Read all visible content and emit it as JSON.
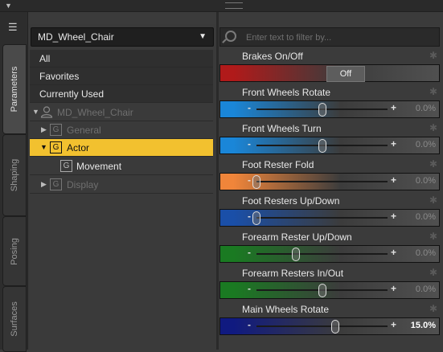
{
  "side_tabs": [
    "Parameters",
    "Shaping",
    "Posing",
    "Surfaces"
  ],
  "figure_dropdown": {
    "value": "MD_Wheel_Chair"
  },
  "nav": {
    "items": [
      {
        "label": "All"
      },
      {
        "label": "Favorites"
      },
      {
        "label": "Currently Used"
      },
      {
        "label": "MD_Wheel_Chair"
      },
      {
        "label": "General",
        "group_icon": "G"
      },
      {
        "label": "Actor",
        "group_icon": "G"
      },
      {
        "label": "Movement",
        "group_icon": "G"
      },
      {
        "label": "Display",
        "group_icon": "G"
      }
    ]
  },
  "filter": {
    "placeholder": "Enter text to filter by..."
  },
  "properties": [
    {
      "name": "Brakes On/Off",
      "type": "toggle",
      "toggle_label": "Off",
      "color": "#b01a1a"
    },
    {
      "name": "Front Wheels Rotate",
      "value": "0.0%",
      "knob_fraction": 0.5,
      "color": "#1a86d8"
    },
    {
      "name": "Front Wheels Turn",
      "value": "0.0%",
      "knob_fraction": 0.5,
      "color": "#1a86d8"
    },
    {
      "name": "Foot Rester Fold",
      "value": "0.0%",
      "knob_fraction": 0.0,
      "color": "#f0853a"
    },
    {
      "name": "Foot Resters Up/Down",
      "value": "0.0%",
      "knob_fraction": 0.0,
      "color": "#1a4fa8"
    },
    {
      "name": "Forearm Rester Up/Down",
      "value": "0.0%",
      "knob_fraction": 0.3,
      "color": "#1a7a22"
    },
    {
      "name": "Forearm Resters In/Out",
      "value": "0.0%",
      "knob_fraction": 0.5,
      "color": "#1a7a22"
    },
    {
      "name": "Main Wheels Rotate",
      "value": "15.0%",
      "knob_fraction": 0.6,
      "color": "#101a80"
    }
  ]
}
